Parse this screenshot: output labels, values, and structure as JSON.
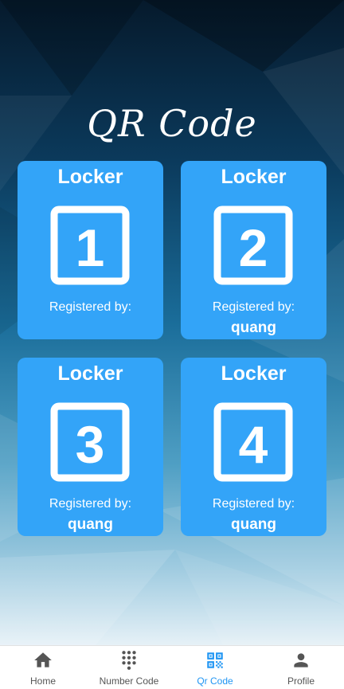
{
  "page": {
    "title": "QR Code"
  },
  "colors": {
    "card": "#33a4f8",
    "nav_active": "#2196f3",
    "nav_inactive": "#555555"
  },
  "lockers": [
    {
      "title": "Locker",
      "number": "1",
      "registered_label": "Registered by:",
      "user": ""
    },
    {
      "title": "Locker",
      "number": "2",
      "registered_label": "Registered by:",
      "user": "quang"
    },
    {
      "title": "Locker",
      "number": "3",
      "registered_label": "Registered by:",
      "user": "quang"
    },
    {
      "title": "Locker",
      "number": "4",
      "registered_label": "Registered by:",
      "user": "quang"
    }
  ],
  "nav": {
    "items": [
      {
        "label": "Home",
        "icon": "home-icon",
        "active": false
      },
      {
        "label": "Number Code",
        "icon": "keypad-icon",
        "active": false
      },
      {
        "label": "Qr Code",
        "icon": "qr-code-icon",
        "active": true
      },
      {
        "label": "Profile",
        "icon": "person-icon",
        "active": false
      }
    ]
  }
}
